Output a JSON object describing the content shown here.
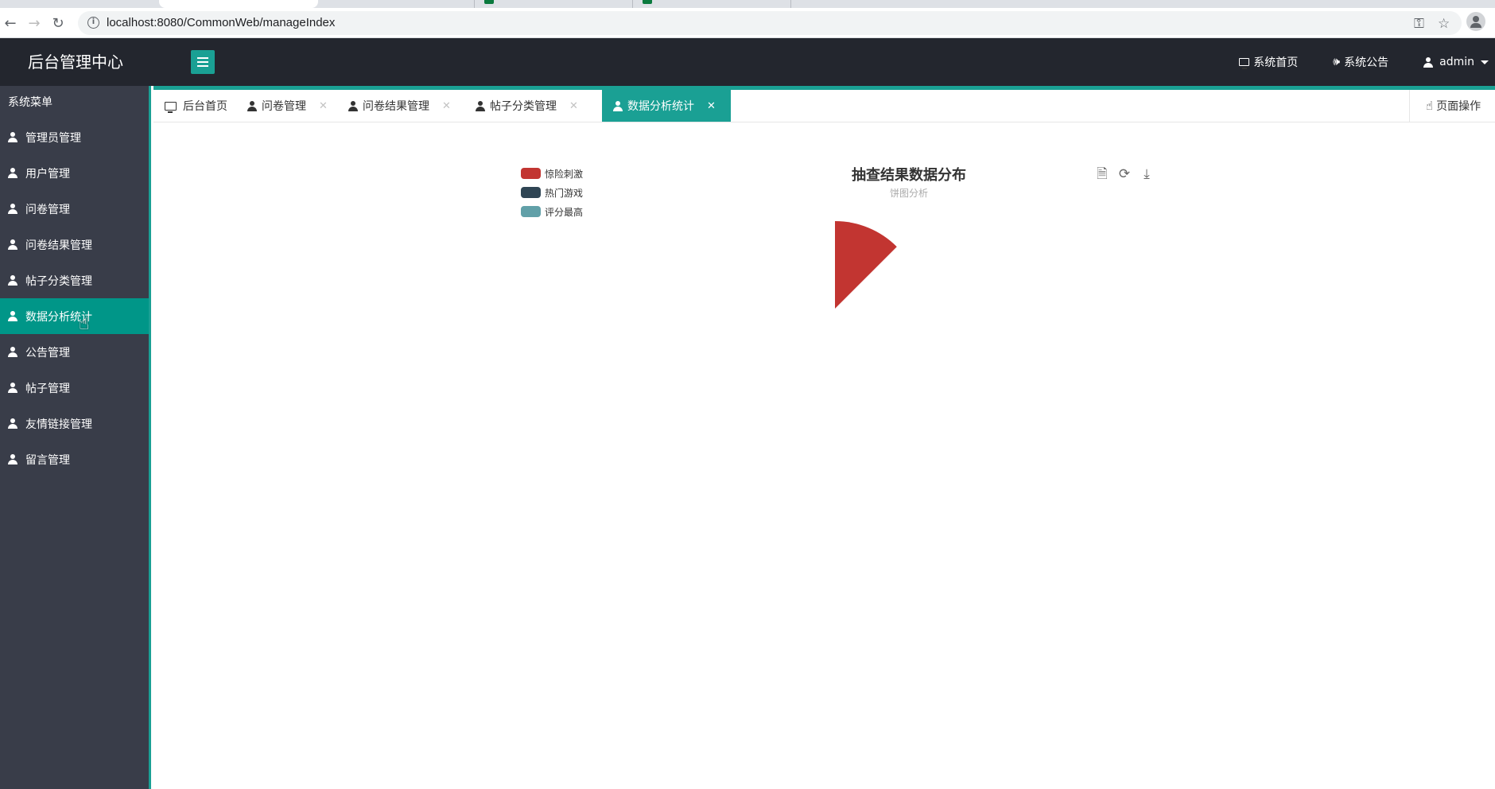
{
  "browser": {
    "url": "localhost:8080/CommonWeb/manageIndex"
  },
  "header": {
    "app_title": "后台管理中心",
    "nav": [
      {
        "label": "系统首页",
        "icon": "monitor-icon"
      },
      {
        "label": "系统公告",
        "icon": "megaphone-icon"
      },
      {
        "label": "admin",
        "icon": "user-icon"
      }
    ]
  },
  "sidebar": {
    "title": "系统菜单",
    "items": [
      {
        "label": "管理员管理"
      },
      {
        "label": "用户管理"
      },
      {
        "label": "问卷管理"
      },
      {
        "label": "问卷结果管理"
      },
      {
        "label": "帖子分类管理"
      },
      {
        "label": "数据分析统计",
        "active": true
      },
      {
        "label": "公告管理"
      },
      {
        "label": "帖子管理"
      },
      {
        "label": "友情链接管理"
      },
      {
        "label": "留言管理"
      }
    ]
  },
  "tabs": [
    {
      "label": "后台首页",
      "icon": "monitor-icon",
      "closable": false
    },
    {
      "label": "问卷管理",
      "icon": "user-icon",
      "closable": true
    },
    {
      "label": "问卷结果管理",
      "icon": "user-icon",
      "closable": true
    },
    {
      "label": "帖子分类管理",
      "icon": "user-icon",
      "closable": true
    },
    {
      "label": "数据分析统计",
      "icon": "user-icon",
      "closable": true,
      "active": true
    }
  ],
  "page_ops_label": "页面操作",
  "colors": {
    "accent": "#1aa094",
    "sidebar_bg": "#393d49",
    "header_bg": "#23262e",
    "active_item": "#009688"
  },
  "chart_data": {
    "type": "pie",
    "title": "抽查结果数据分布",
    "subtitle": "饼图分析",
    "legend_position": "top-left",
    "series": [
      {
        "name": "惊险刺激",
        "value": 1,
        "color": "#c23531"
      },
      {
        "name": "热门游戏",
        "value": 0,
        "color": "#2f4554"
      },
      {
        "name": "评分最高",
        "value": 0,
        "color": "#61a0a8"
      }
    ],
    "visible_slice_fraction": 0.125,
    "toolbox": [
      "data-view-icon",
      "refresh-icon",
      "download-icon"
    ]
  }
}
